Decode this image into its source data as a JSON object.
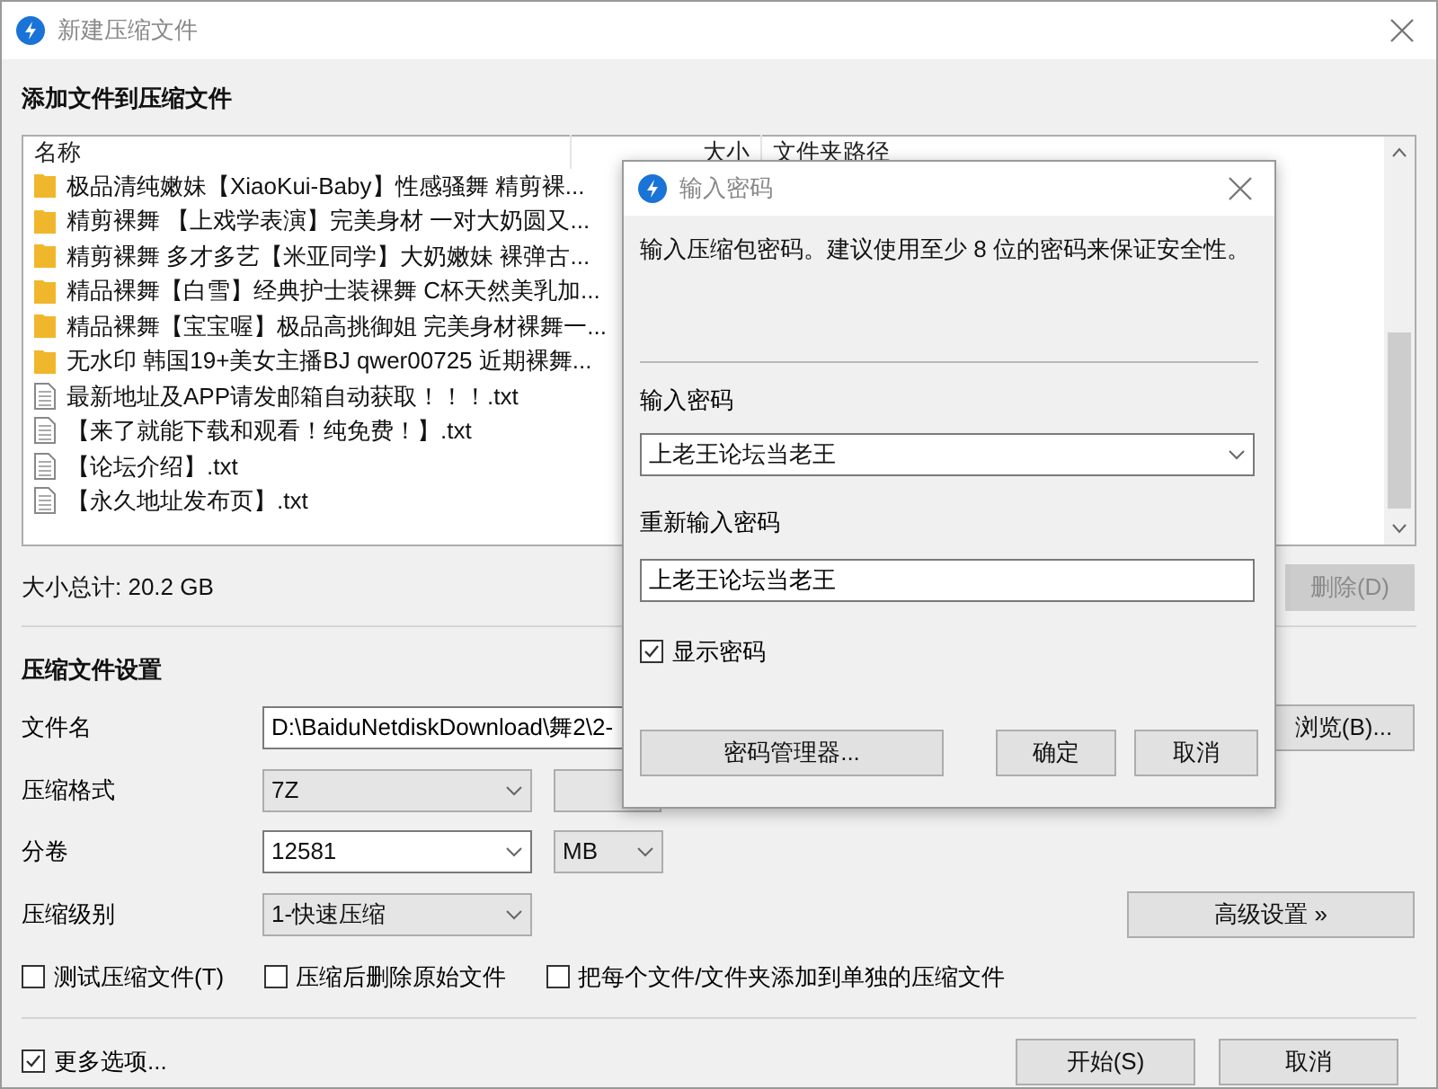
{
  "window": {
    "title": "新建压缩文件"
  },
  "add_section": {
    "title": "添加文件到压缩文件",
    "columns": [
      "名称",
      "大小",
      "文件夹路径"
    ],
    "files": [
      {
        "kind": "folder",
        "name": "极品清纯嫩妹【XiaoKui-Baby】性感骚舞 精剪裸..."
      },
      {
        "kind": "folder",
        "name": "精剪裸舞 【上戏学表演】完美身材 一对大奶圆又..."
      },
      {
        "kind": "folder",
        "name": "精剪裸舞 多才多艺【米亚同学】大奶嫩妹 裸弹古..."
      },
      {
        "kind": "folder",
        "name": "精品裸舞【白雪】经典护士装裸舞 C杯天然美乳加..."
      },
      {
        "kind": "folder",
        "name": "精品裸舞【宝宝喔】极品高挑御姐 完美身材裸舞一..."
      },
      {
        "kind": "folder",
        "name": "无水印 韩国19+美女主播BJ qwer00725 近期裸舞..."
      },
      {
        "kind": "file",
        "name": "最新地址及APP请发邮箱自动获取！！！.txt"
      },
      {
        "kind": "file",
        "name": "【来了就能下载和观看！纯免费！】.txt"
      },
      {
        "kind": "file",
        "name": "【论坛介绍】.txt"
      },
      {
        "kind": "file",
        "name": "【永久地址发布页】.txt"
      }
    ],
    "total_size": "大小总计: 20.2 GB",
    "delete_button": {
      "label": "删除(D)",
      "disabled": true
    }
  },
  "settings": {
    "title": "压缩文件设置",
    "filename_label": "文件名",
    "filename_value": "D:\\BaiduNetdiskDownload\\舞2\\2-",
    "browse_button": "浏览(B)...",
    "format_label": "压缩格式",
    "format_value": "7Z",
    "volume_label": "分卷",
    "volume_value": "12581",
    "volume_unit": "MB",
    "level_label": "压缩级别",
    "level_value": "1-快速压缩",
    "advanced_button": "高级设置 »",
    "options": [
      {
        "label": "测试压缩文件(T)",
        "checked": false
      },
      {
        "label": "压缩后删除原始文件",
        "checked": false
      },
      {
        "label": "把每个文件/文件夹添加到单独的压缩文件",
        "checked": false
      }
    ]
  },
  "footer": {
    "more_options": {
      "label": "更多选项...",
      "checked": true
    },
    "buttons": [
      "开始(S)",
      "取消"
    ]
  },
  "password_dialog": {
    "title": "输入密码",
    "message": "输入压缩包密码。建议使用至少 8 位的密码来保证安全性。",
    "password_label": "输入密码",
    "password_value": "上老王论坛当老王",
    "confirm_label": "重新输入密码",
    "confirm_value": "上老王论坛当老王",
    "show_password": {
      "label": "显示密码",
      "checked": true
    },
    "manager_button": "密码管理器...",
    "ok_button": "确定",
    "cancel_button": "取消"
  }
}
